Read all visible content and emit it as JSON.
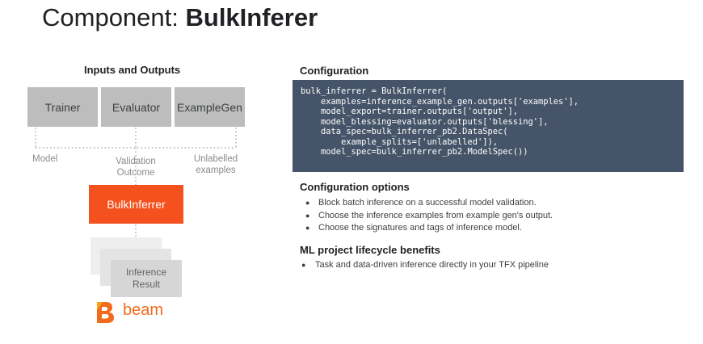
{
  "title": {
    "prefix": "Component: ",
    "name": "BulkInferer"
  },
  "diagram": {
    "heading": "Inputs and Outputs",
    "inputs": [
      "Trainer",
      "Evaluator",
      "ExampleGen"
    ],
    "edge_labels": {
      "model": "Model",
      "validation_line1": "Validation",
      "validation_line2": "Outcome",
      "unlabelled_line1": "Unlabelled",
      "unlabelled_line2": "examples"
    },
    "component": "BulkInferrer",
    "output_line1": "Inference",
    "output_line2": "Result",
    "runner": "beam"
  },
  "configuration": {
    "heading": "Configuration",
    "code": "bulk_inferrer = BulkInferrer(\n    examples=inference_example_gen.outputs['examples'],\n    model_export=trainer.outputs['output'],\n    model_blessing=evaluator.outputs['blessing'],\n    data_spec=bulk_inferrer_pb2.DataSpec(\n        example_splits=['unlabelled']),\n    model_spec=bulk_inferrer_pb2.ModelSpec())"
  },
  "config_options": {
    "heading": "Configuration options",
    "items": [
      "Block batch inference on a successful model validation.",
      "Choose the inference examples from example gen's output.",
      "Choose the signatures and tags of inference model."
    ]
  },
  "lifecycle": {
    "heading": "ML project lifecycle benefits",
    "items": [
      "Task and data-driven inference directly in your TFX pipeline"
    ]
  },
  "colors": {
    "component": "#f4511e",
    "code_background": "#455468",
    "input_box": "#bdbdbd",
    "beam": "#f26b1d"
  }
}
